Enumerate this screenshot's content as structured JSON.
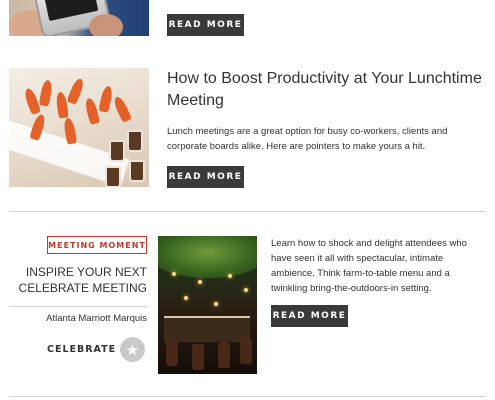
{
  "articles": [
    {
      "button_label": "READ MORE"
    },
    {
      "title": "How to Boost Productivity at Your Lunchtime Meeting",
      "description": "Lunch meetings are a great option for busy co-workers, clients and corporate boards alike. Here are pointers to make yours a hit.",
      "button_label": "READ MORE"
    }
  ],
  "meeting_moment": {
    "badge": "MEETING MOMENT",
    "title": "INSPIRE YOUR NEXT CELEBRATE MEETING",
    "venue": "Atlanta Marriott Marquis",
    "category": "CELEBRATE",
    "category_icon": "star-icon",
    "description": "Learn how to shock and delight attendees who have seen it all with spectacular, intimate ambience. Think farm-to-table menu and a twinkling bring-the-outdoors-in setting.",
    "button_label": "READ MORE"
  },
  "colors": {
    "button_bg": "#3a3a3a",
    "accent_red": "#c0392b",
    "divider": "#d4d4d4"
  }
}
